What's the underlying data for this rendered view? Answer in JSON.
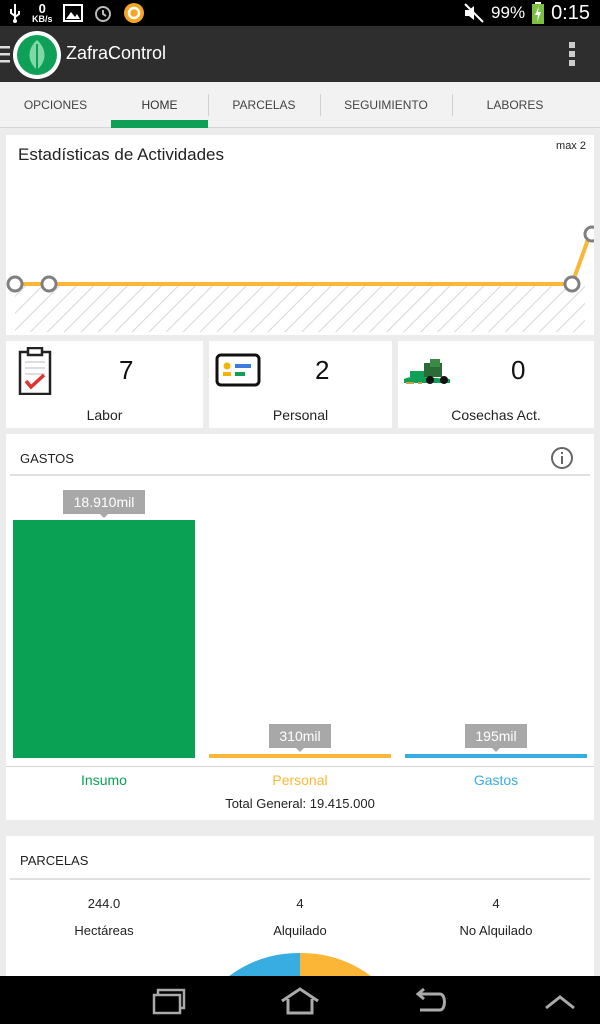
{
  "status_bar": {
    "kbs_value": "0",
    "kbs_unit": "KB/s",
    "battery": "99%",
    "time": "0:15"
  },
  "app_bar": {
    "title": "ZafraControl"
  },
  "tabs": [
    {
      "label": "OPCIONES"
    },
    {
      "label": "HOME"
    },
    {
      "label": "PARCELAS"
    },
    {
      "label": "SEGUIMIENTO"
    },
    {
      "label": "LABORES"
    }
  ],
  "stats": {
    "title": "Estadísticas de Actividades",
    "max_label": "max 2"
  },
  "counters": [
    {
      "value": "7",
      "label": "Labor",
      "icon": "clipboard-check-icon"
    },
    {
      "value": "2",
      "label": "Personal",
      "icon": "id-card-icon"
    },
    {
      "value": "0",
      "label": "Cosechas Act.",
      "icon": "harvester-icon"
    }
  ],
  "gastos": {
    "title": "GASTOS",
    "total": "Total General: 19.415.000"
  },
  "chart_data": {
    "type": "bar",
    "categories": [
      "Insumo",
      "Personal",
      "Gastos"
    ],
    "values": [
      18910,
      310,
      195
    ],
    "data_labels": [
      "18.910mil",
      "310mil",
      "195mil"
    ],
    "colors": [
      "#0ba155",
      "#fbb638",
      "#38ade2"
    ]
  },
  "parcelas": {
    "title": "PARCELAS",
    "items": [
      {
        "value": "244.0",
        "label": "Hectáreas"
      },
      {
        "value": "4",
        "label": "Alquilado"
      },
      {
        "value": "4",
        "label": "No Alquilado"
      }
    ]
  },
  "colors": {
    "accent": "#0fa057",
    "appbar": "#2e2e2e",
    "line": "#fbb638"
  }
}
